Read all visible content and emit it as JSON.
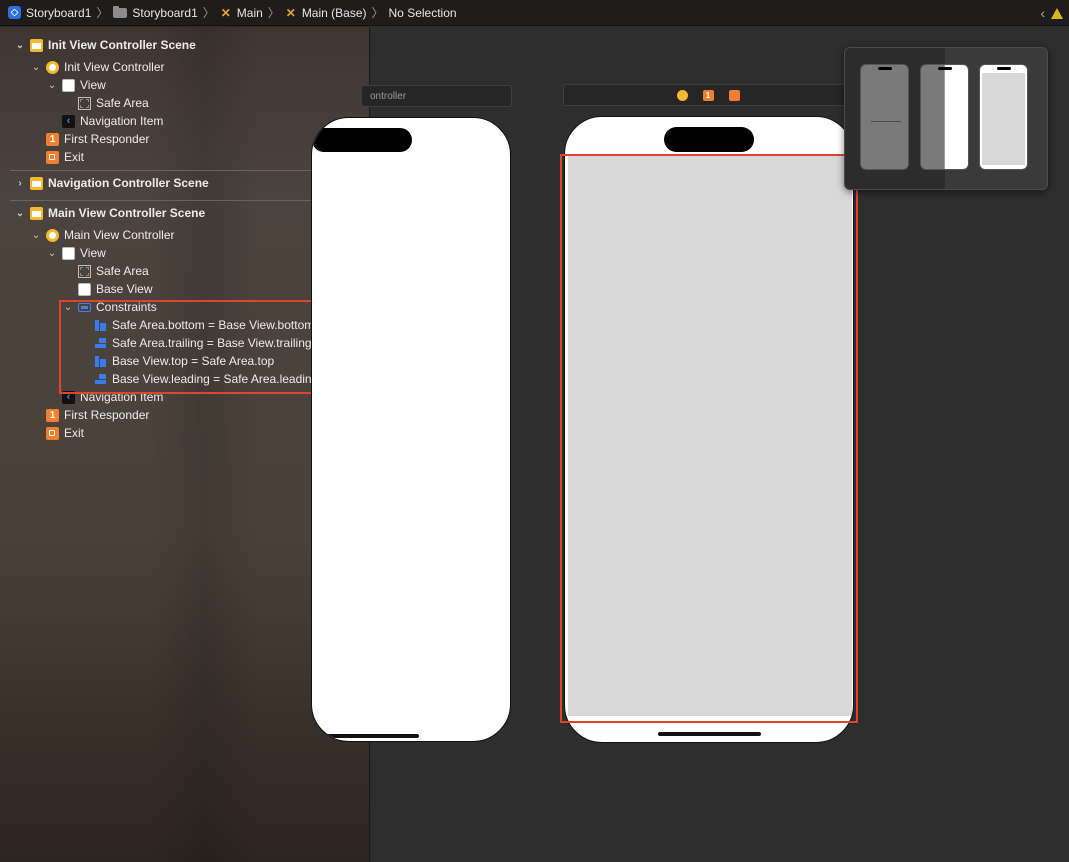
{
  "breadcrumb": {
    "items": [
      "Storyboard1",
      "Storyboard1",
      "Main",
      "Main (Base)",
      "No Selection"
    ]
  },
  "outline": {
    "scene1": {
      "title": "Init View Controller Scene",
      "controller": "Init View Controller",
      "view": "View",
      "safe_area": "Safe Area",
      "navigation_item": "Navigation Item",
      "first_responder": "First Responder",
      "exit": "Exit"
    },
    "scene2": {
      "title": "Navigation Controller Scene"
    },
    "scene3": {
      "title": "Main View Controller Scene",
      "controller": "Main View Controller",
      "view": "View",
      "safe_area": "Safe Area",
      "base_view": "Base View",
      "constraints_label": "Constraints",
      "constraints": [
        "Safe Area.bottom = Base View.bottom",
        "Safe Area.trailing = Base View.trailing",
        "Base View.top = Safe Area.top",
        "Base View.leading = Safe Area.leading"
      ],
      "navigation_item": "Navigation Item",
      "first_responder": "First Responder",
      "exit": "Exit"
    }
  },
  "canvas": {
    "left_scene_title": "ontroller",
    "first_responder_badge": "1"
  },
  "colors": {
    "highlight": "#e0442a",
    "accent_orange": "#f07f2f",
    "constraint_blue": "#3a7cf0"
  }
}
